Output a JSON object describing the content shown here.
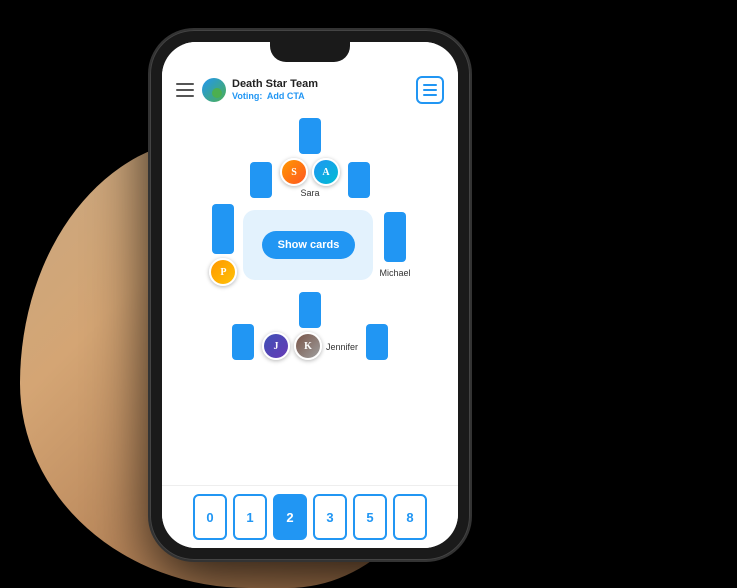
{
  "header": {
    "menu_label": "☰",
    "team_name": "Death Star Team",
    "voting_label": "Voting:",
    "cta_label": "Add CTA",
    "list_icon": "list"
  },
  "players": {
    "top": {
      "name": "Sara",
      "cards": [
        {
          "id": "top-card-1"
        },
        {
          "id": "top-card-2"
        },
        {
          "id": "top-card-3"
        }
      ]
    },
    "right": {
      "name": "Michael",
      "cards": [
        {
          "id": "right-card-1"
        }
      ]
    },
    "left": {
      "cards": [
        {
          "id": "left-card-1"
        }
      ]
    },
    "bottom": {
      "name": "Jennifer",
      "cards": [
        {
          "id": "bottom-card-1"
        },
        {
          "id": "bottom-card-2"
        },
        {
          "id": "bottom-card-3"
        }
      ]
    }
  },
  "center": {
    "show_cards_label": "Show cards"
  },
  "voting_cards": [
    {
      "value": "0",
      "selected": false
    },
    {
      "value": "1",
      "selected": false
    },
    {
      "value": "2",
      "selected": true
    },
    {
      "value": "3",
      "selected": false
    },
    {
      "value": "5",
      "selected": false
    },
    {
      "value": "8",
      "selected": false
    }
  ]
}
